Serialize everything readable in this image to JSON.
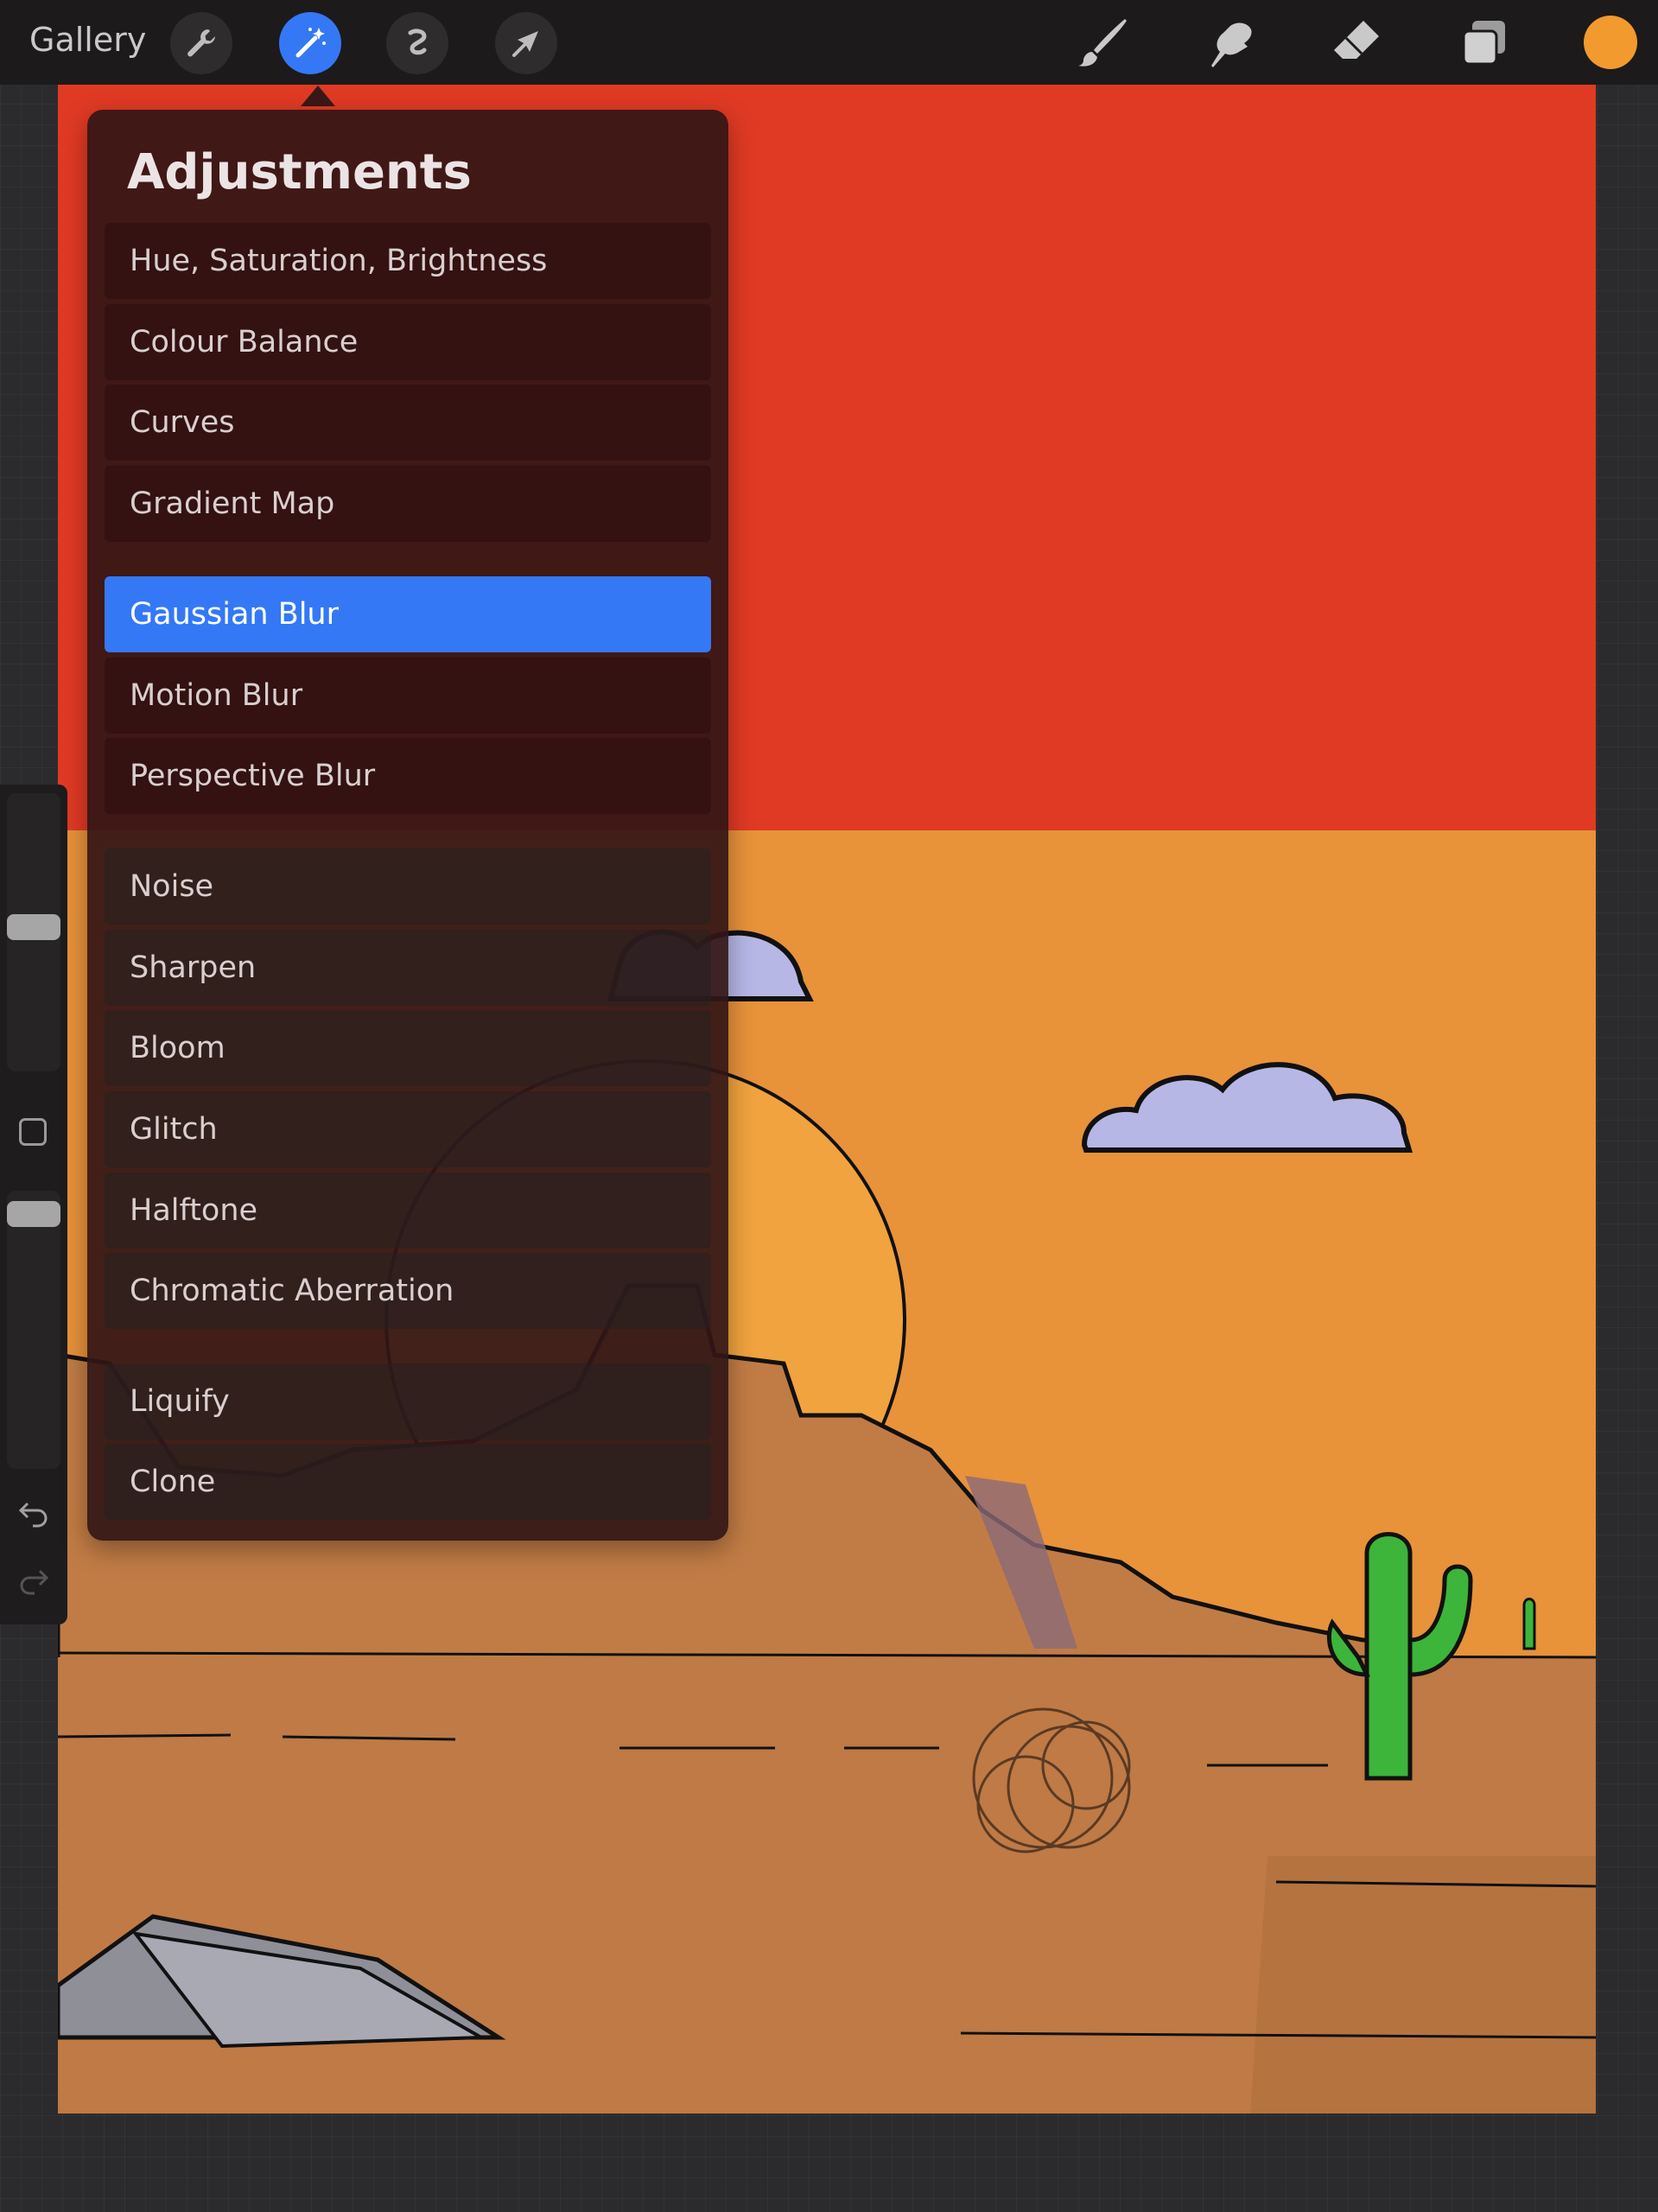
{
  "toolbar": {
    "gallery_label": "Gallery",
    "left_tools": [
      "wrench-icon",
      "magic-wand-icon",
      "selection-icon",
      "transform-arrow-icon"
    ],
    "right_tools": [
      "brush-icon",
      "smudge-icon",
      "eraser-icon",
      "layers-icon"
    ],
    "active_color": "#f29a2e",
    "active_tool": "adjustments"
  },
  "adjustments": {
    "title": "Adjustments",
    "groups": [
      {
        "items": [
          "Hue, Saturation, Brightness",
          "Colour Balance",
          "Curves",
          "Gradient Map"
        ]
      },
      {
        "items": [
          "Gaussian Blur",
          "Motion Blur",
          "Perspective Blur"
        ]
      },
      {
        "items": [
          "Noise",
          "Sharpen",
          "Bloom",
          "Glitch",
          "Halftone",
          "Chromatic Aberration"
        ]
      },
      {
        "items": [
          "Liquify",
          "Clone"
        ]
      }
    ],
    "selected": "Gaussian Blur",
    "selected_color": "#3478f6"
  },
  "canvas": {
    "description_colors": {
      "sky_top": "#e03a24",
      "sky_bottom": "#e8923a",
      "ground": "#bf7a45",
      "cactus": "#3cb53a"
    }
  }
}
